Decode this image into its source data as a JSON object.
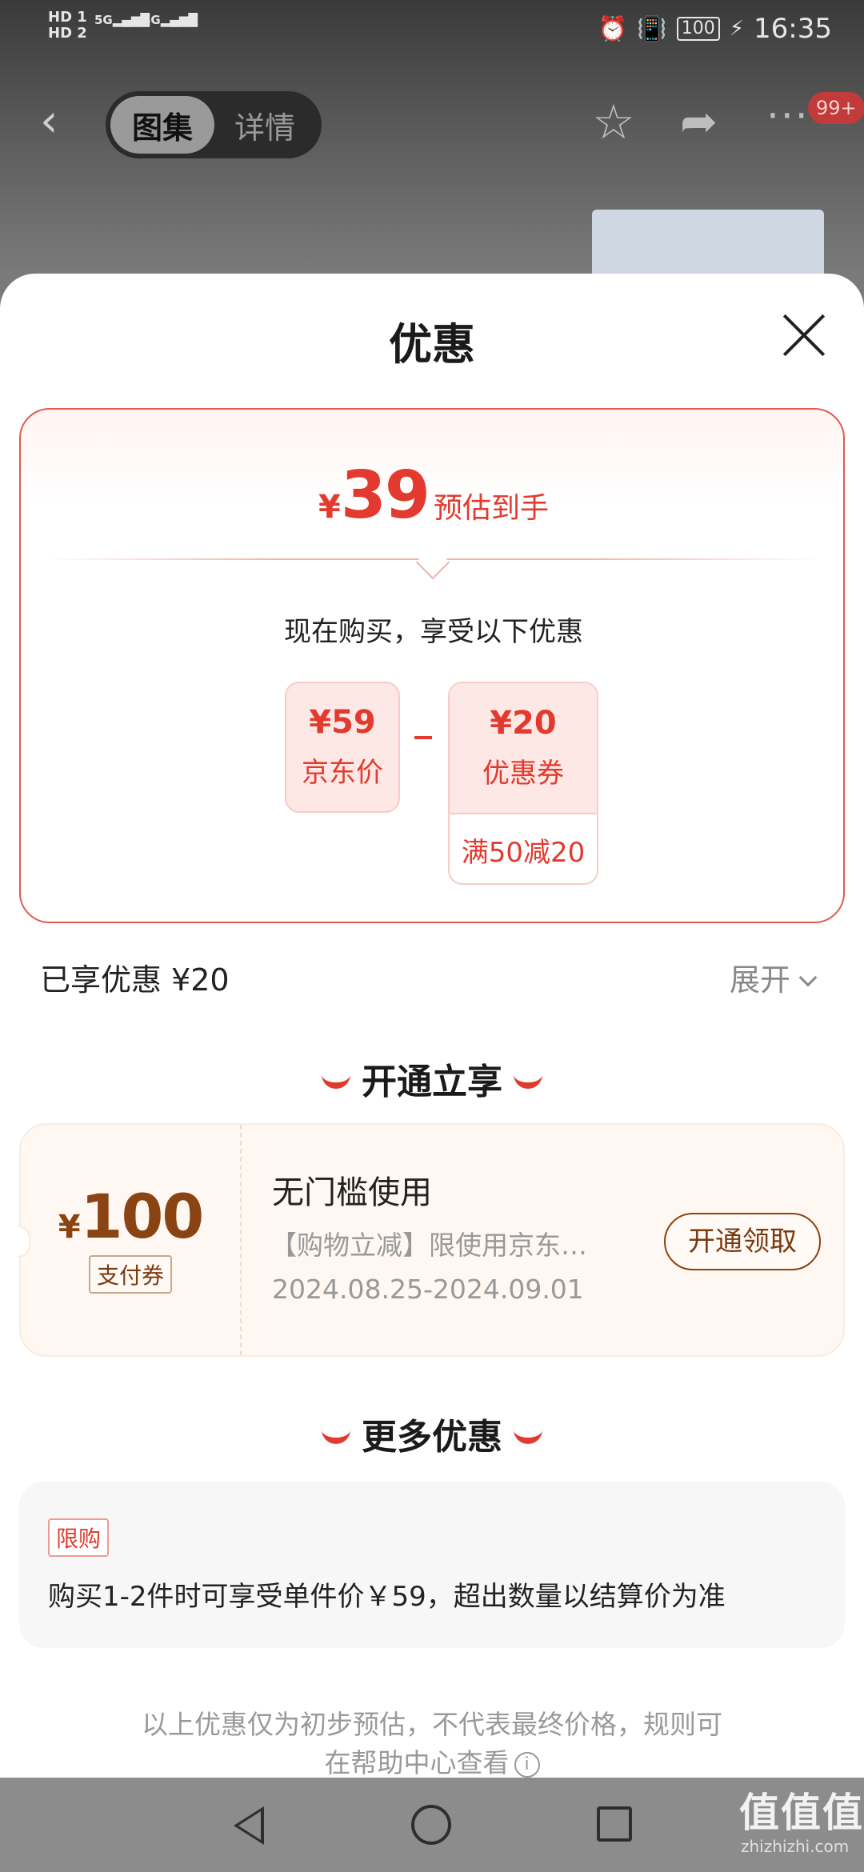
{
  "status": {
    "hd1": "HD 1",
    "hd2": "HD 2",
    "sig1": "5G",
    "sig2": "4G",
    "battery": "100",
    "time": "16:35"
  },
  "topbar": {
    "tab_gallery": "图集",
    "tab_details": "详情",
    "badge": "99+"
  },
  "sheet": {
    "title": "优惠",
    "estimate": {
      "currency": "¥",
      "price": "39",
      "label": "预估到手"
    },
    "buy_now": "现在购买，享受以下优惠",
    "jd_price": {
      "amount": "¥59",
      "caption": "京东价"
    },
    "coupon": {
      "amount": "¥20",
      "caption": "优惠券",
      "condition": "满50减20"
    },
    "enjoyed": "已享优惠 ¥20",
    "expand": "展开",
    "section_open": "开通立享",
    "vip_coupon": {
      "currency": "¥",
      "value": "100",
      "tag": "支付券",
      "title": "无门槛使用",
      "desc": "【购物立减】限使用京东…",
      "dates": "2024.08.25-2024.09.01",
      "button": "开通领取"
    },
    "section_more": "更多优惠",
    "limit": {
      "tag": "限购",
      "text": "购买1-2件时可享受单件价￥59，超出数量以结算价为准"
    },
    "disclaimer_line1": "以上优惠仅为初步预估，不代表最终价格，规则可",
    "disclaimer_line2": "在帮助中心查看"
  },
  "watermark": {
    "main": "值值值",
    "sub": "zhizhizhi.com"
  },
  "colors": {
    "accent": "#e23a2e",
    "vip_brown": "#8a4312"
  }
}
